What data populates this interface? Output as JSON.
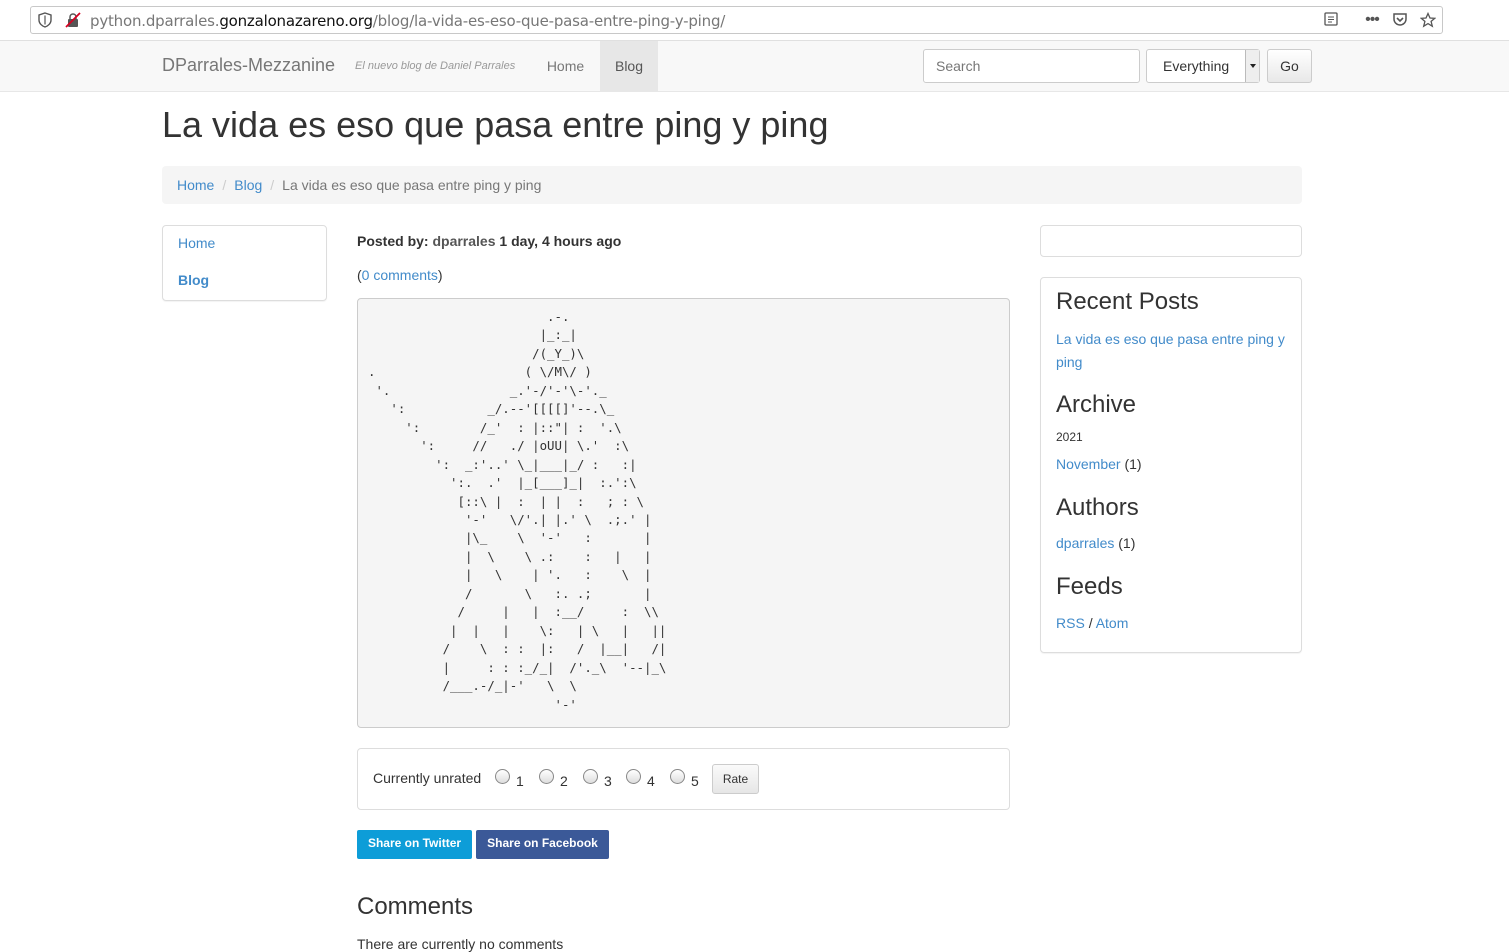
{
  "browser": {
    "url_prefix": "python.dparrales.",
    "url_domain": "gonzalonazareno.org",
    "url_path": "/blog/la-vida-es-eso-que-pasa-entre-ping-y-ping/"
  },
  "navbar": {
    "brand": "DParrales-Mezzanine",
    "tagline": "El nuevo blog de Daniel Parrales",
    "home": "Home",
    "blog": "Blog",
    "search_placeholder": "Search",
    "select_value": "Everything",
    "go": "Go"
  },
  "page": {
    "title": "La vida es eso que pasa entre ping y ping"
  },
  "breadcrumb": {
    "home": "Home",
    "blog": "Blog",
    "current": "La vida es eso que pasa entre ping y ping"
  },
  "leftnav": {
    "home": "Home",
    "blog": "Blog"
  },
  "post": {
    "posted_by_label": "Posted by:",
    "author": "dparrales",
    "time": "1 day, 4 hours ago",
    "comments_open": "(",
    "comments_link": "0 comments",
    "comments_close": ")",
    "ascii_art": "                        .-.\n                       |_:_|\n                      /(_Y_)\\\n.                    ( \\/M\\/ )\n '.                _.'-/'-'\\-'._\n   ':           _/.--'[[[[]'--.\\_\n     ':        /_'  : |::\"| :  '.\\\n       ':     //   ./ |oUU| \\.'  :\\\n         ':  _:'..' \\_|___|_/ :   :|\n           ':.  .'  |_[___]_|  :.':\\\n            [::\\ |  :  | |  :   ; : \\\n             '-'   \\/'.| |.' \\  .;.' |\n             |\\_    \\  '-'   :       |\n             |  \\    \\ .:    :   |   |\n             |   \\    | '.   :    \\  |\n             /       \\   :. .;       |\n            /     |   |  :__/     :  \\\\\n           |  |   |    \\:   | \\   |   ||\n          /    \\  : :  |:   /  |__|   /|\n          |     : : :_/_|  /'._\\  '--|_\\\n          /___.-/_|-'   \\  \\\n                         '-'"
  },
  "rating": {
    "label": "Currently unrated",
    "options": [
      "1",
      "2",
      "3",
      "4",
      "5"
    ],
    "button": "Rate"
  },
  "share": {
    "twitter": "Share on Twitter",
    "facebook": "Share on Facebook"
  },
  "comments": {
    "heading": "Comments",
    "empty": "There are currently no comments"
  },
  "sidebar": {
    "recent_heading": "Recent Posts",
    "recent_post": "La vida es eso que pasa entre ping y ping",
    "archive_heading": "Archive",
    "archive_year": "2021",
    "archive_month": "November",
    "archive_count": "(1)",
    "authors_heading": "Authors",
    "author_name": "dparrales",
    "author_count": "(1)",
    "feeds_heading": "Feeds",
    "rss": "RSS",
    "feeds_sep": "/",
    "atom": "Atom"
  },
  "colors": {
    "link": "#428bca",
    "twitter": "#0d9dd8",
    "facebook": "#3b5998"
  }
}
